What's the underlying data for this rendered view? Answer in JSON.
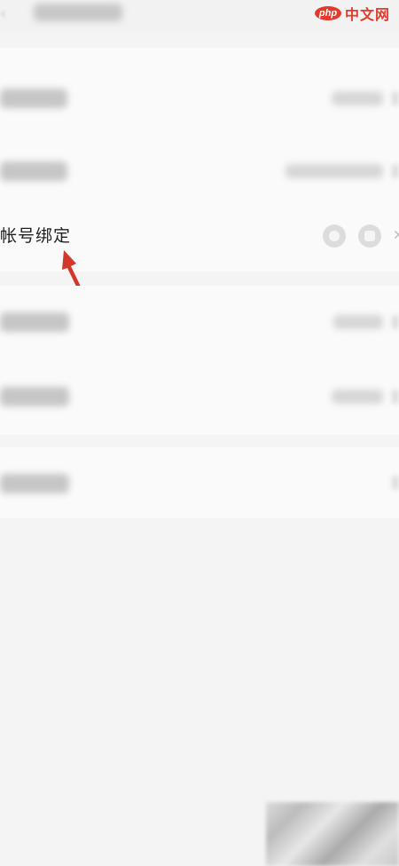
{
  "watermark": {
    "logo": "php",
    "text": "中文网"
  },
  "account": {
    "label": "帐号绑定",
    "chevron": "›",
    "icons": [
      "circle-icon",
      "square-icon"
    ]
  },
  "colors": {
    "background": "#f4f4f4",
    "card": "#fafafa",
    "arrow": "#d3372b",
    "watermark": "#e33a2b"
  }
}
